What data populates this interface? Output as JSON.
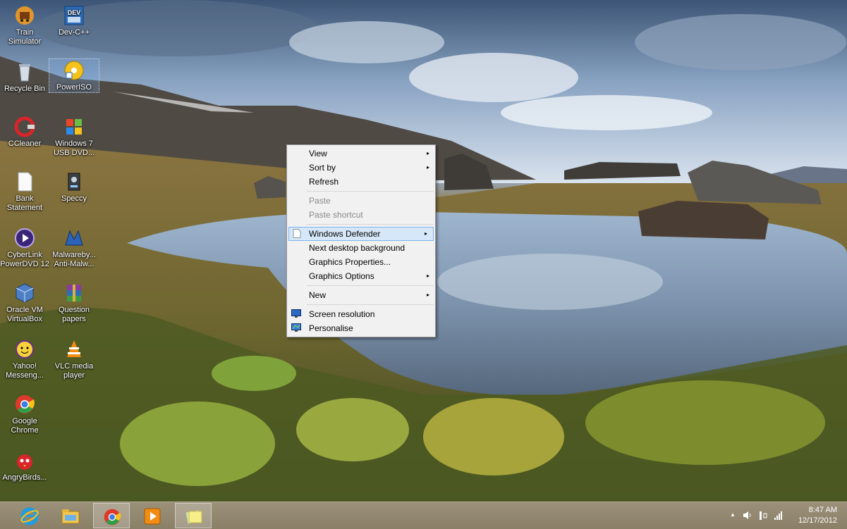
{
  "desktop_icons": [
    {
      "label": "Train Simulator",
      "icon": "train-icon"
    },
    {
      "label": "Dev-C++",
      "icon": "devcpp-icon"
    },
    {
      "label": "Recycle Bin",
      "icon": "recycle-bin-icon"
    },
    {
      "label": "PowerISO",
      "icon": "poweriso-icon"
    },
    {
      "label": "CCleaner",
      "icon": "ccleaner-icon"
    },
    {
      "label": "Windows 7 USB DVD...",
      "icon": "windows-usb-icon"
    },
    {
      "label": "Bank Statement",
      "icon": "document-icon"
    },
    {
      "label": "Speccy",
      "icon": "speccy-icon"
    },
    {
      "label": "CyberLink PowerDVD 12",
      "icon": "powerdvd-icon"
    },
    {
      "label": "Malwareby... Anti-Malw...",
      "icon": "malwarebytes-icon"
    },
    {
      "label": "Oracle VM VirtualBox",
      "icon": "virtualbox-icon"
    },
    {
      "label": "Question papers",
      "icon": "winrar-icon"
    },
    {
      "label": "Yahoo! Messeng...",
      "icon": "yahoo-icon"
    },
    {
      "label": "VLC media player",
      "icon": "vlc-icon"
    },
    {
      "label": "Google Chrome",
      "icon": "chrome-icon"
    },
    {
      "label": "AngryBirds...",
      "icon": "angrybirds-icon"
    }
  ],
  "context_menu": {
    "items": [
      {
        "label": "View",
        "submenu": true
      },
      {
        "label": "Sort by",
        "submenu": true
      },
      {
        "label": "Refresh"
      },
      {
        "label": "Paste",
        "disabled": true
      },
      {
        "label": "Paste shortcut",
        "disabled": true
      },
      {
        "label": "Windows Defender",
        "submenu": true,
        "highlighted": true,
        "icon": "page-icon"
      },
      {
        "label": "Next desktop background"
      },
      {
        "label": "Graphics Properties..."
      },
      {
        "label": "Graphics Options",
        "submenu": true
      },
      {
        "label": "New",
        "submenu": true
      },
      {
        "label": "Screen resolution",
        "icon": "monitor-icon"
      },
      {
        "label": "Personalise",
        "icon": "personalise-icon"
      }
    ],
    "arrow": "▸"
  },
  "taskbar": {
    "apps": [
      "internet-explorer-icon",
      "file-explorer-icon",
      "chrome-icon",
      "media-player-icon",
      "sticky-notes-icon"
    ],
    "active_app": "chrome-icon",
    "tray_icons": [
      "show-hidden-icons-icon",
      "volume-icon",
      "network-icon",
      "signal-icon"
    ],
    "show_hidden_glyph": "▲",
    "time": "8:47 AM",
    "date": "12/17/2012"
  },
  "colors": {
    "menu_bg": "#f1f1f1",
    "menu_highlight": "#d5e7f8",
    "taskbar_bg": "#8f846c"
  }
}
